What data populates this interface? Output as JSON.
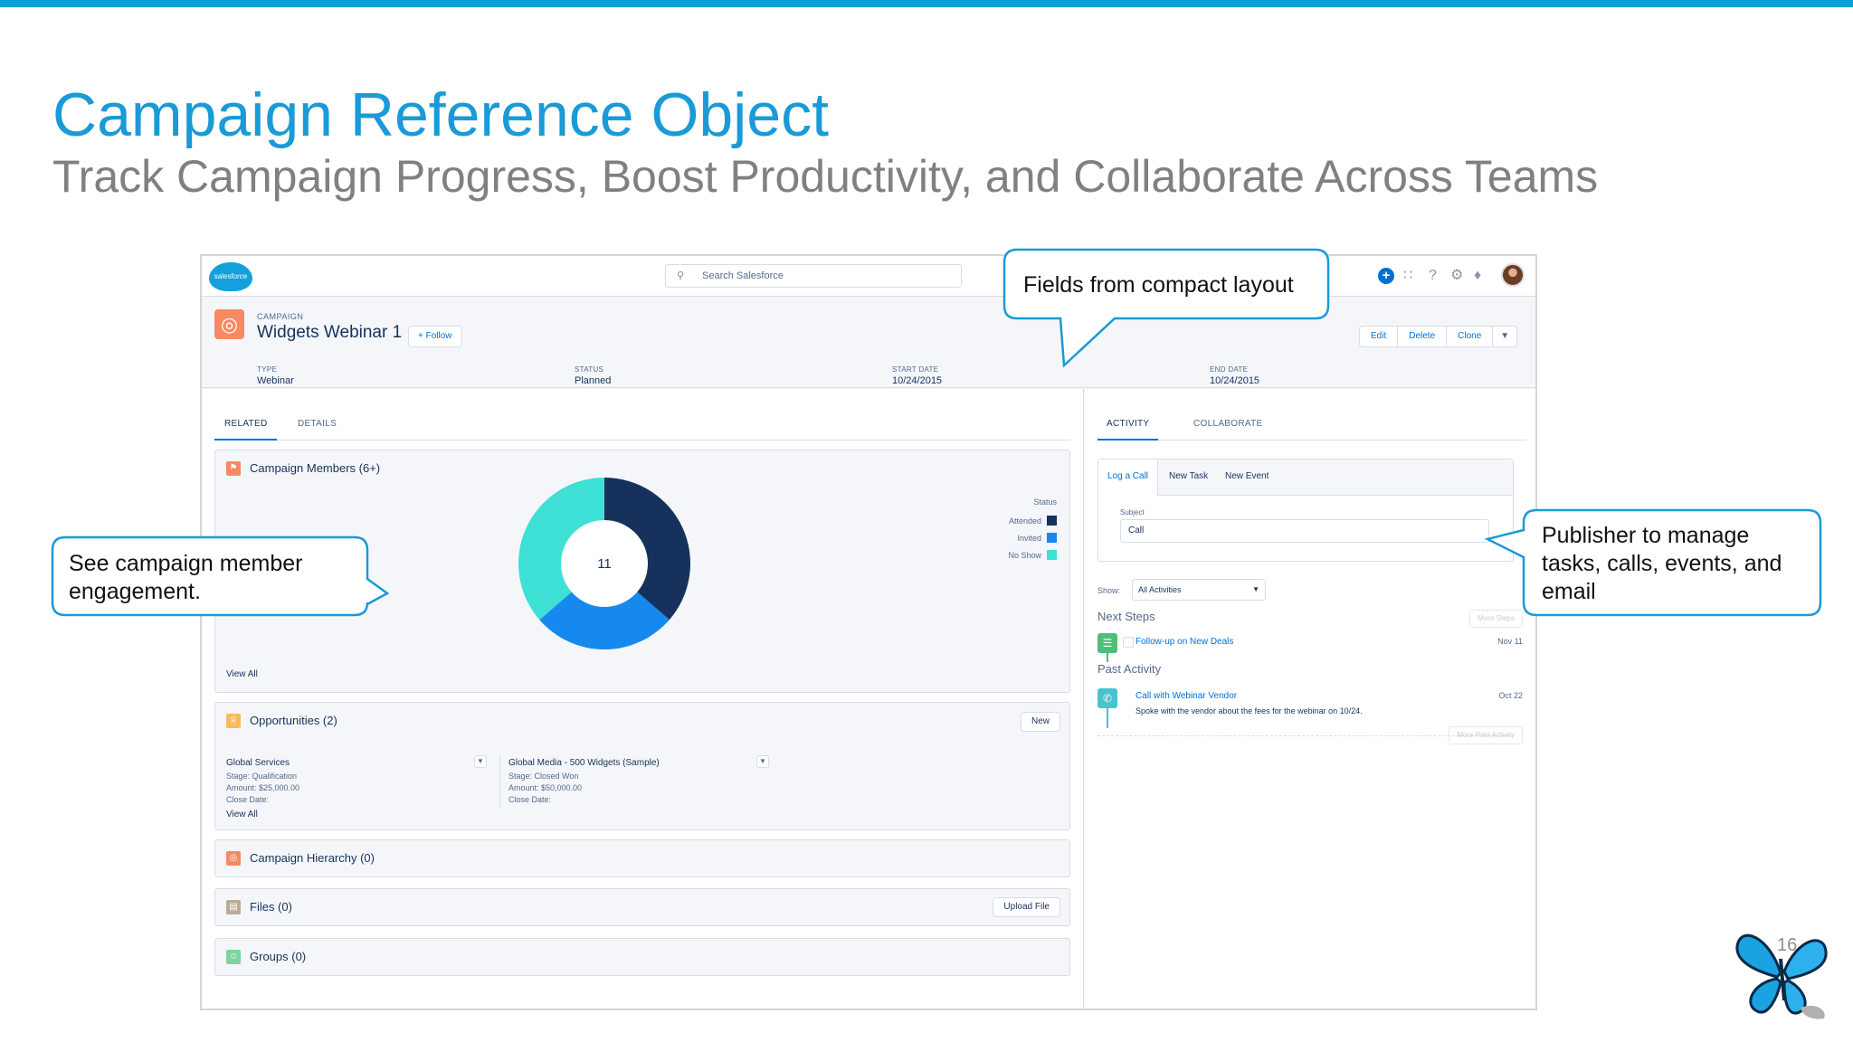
{
  "slide": {
    "title": "Campaign Reference Object",
    "subtitle": "Track Campaign Progress, Boost Productivity, and Collaborate Across Teams",
    "page_number": "16",
    "accent_color": "#0d9dda"
  },
  "app": {
    "logo_text": "salesforce",
    "search_placeholder": "Search Salesforce",
    "header_icons": [
      "add-icon",
      "app-launcher-icon",
      "help-icon",
      "setup-gear-icon",
      "notification-bell-icon",
      "avatar"
    ]
  },
  "record": {
    "object_label": "CAMPAIGN",
    "name": "Widgets Webinar 1",
    "follow_label": "+ Follow",
    "actions": [
      "Edit",
      "Delete",
      "Clone"
    ],
    "fields": [
      {
        "label": "TYPE",
        "value": "Webinar"
      },
      {
        "label": "STATUS",
        "value": "Planned"
      },
      {
        "label": "START DATE",
        "value": "10/24/2015"
      },
      {
        "label": "END DATE",
        "value": "10/24/2015"
      }
    ]
  },
  "left_tabs": [
    "RELATED",
    "DETAILS"
  ],
  "members_card": {
    "title": "Campaign Members (6+)",
    "view_all": "View All",
    "chart": {
      "center_label": "11",
      "legend_title": "Status"
    }
  },
  "chart_data": {
    "type": "pie",
    "title": "",
    "legend_title": "Status",
    "center_label": "11",
    "categories": [
      "Attended",
      "Invited",
      "No Show"
    ],
    "values": [
      4,
      3,
      4
    ],
    "colors": [
      "#16325c",
      "#1589ee",
      "#3ee0d5"
    ]
  },
  "opportunities_card": {
    "title": "Opportunities (2)",
    "new_label": "New",
    "view_all": "View All",
    "items": [
      {
        "name": "Global Services",
        "stage": "Stage:  Qualification",
        "amount": "Amount:  $25,000.00",
        "close": "Close Date:"
      },
      {
        "name": "Global Media - 500 Widgets (Sample)",
        "stage": "Stage:  Closed Won",
        "amount": "Amount:  $50,000.00",
        "close": "Close Date:"
      }
    ]
  },
  "hierarchy_card": {
    "title": "Campaign Hierarchy (0)"
  },
  "files_card": {
    "title": "Files (0)",
    "upload_label": "Upload File"
  },
  "groups_card": {
    "title": "Groups (0)"
  },
  "right_tabs": [
    "ACTIVITY",
    "COLLABORATE"
  ],
  "publisher": {
    "tabs": [
      "Log a Call",
      "New Task",
      "New Event"
    ],
    "subject_label": "Subject",
    "subject_value": "Call",
    "show_label": "Show:",
    "show_value": "All Activities"
  },
  "next_steps": {
    "title": "Next Steps",
    "more_label": "More Steps",
    "items": [
      {
        "label": "Follow-up on New Deals",
        "date": "Nov 11"
      }
    ]
  },
  "past_activity": {
    "title": "Past Activity",
    "more_label": "More Past Activity",
    "items": [
      {
        "label": "Call with Webinar Vendor",
        "detail": "Spoke with the vendor about the fees for the webinar on 10/24.",
        "date": "Oct 22"
      }
    ]
  },
  "callouts": {
    "compact": "Fields from compact layout",
    "members_line1": "See campaign member",
    "members_line2": "engagement.",
    "publisher_line1": "Publisher to manage",
    "publisher_line2": "tasks, calls, events, and",
    "publisher_line3": "email"
  }
}
